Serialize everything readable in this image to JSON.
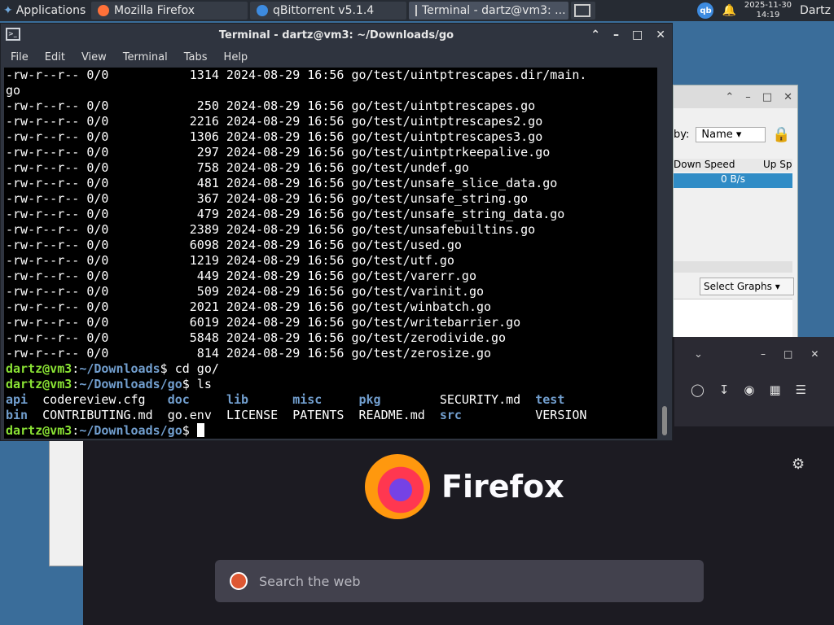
{
  "taskbar": {
    "apps_label": "Applications",
    "windows": [
      {
        "title": "Mozilla Firefox",
        "icon": "firefox-icon"
      },
      {
        "title": "qBittorrent v5.1.4",
        "icon": "qbittorrent-icon"
      },
      {
        "title": "Terminal - dartz@vm3: ...",
        "icon": "terminal-icon"
      }
    ],
    "qb_tray": "qb",
    "date": "2025-11-30",
    "time": "14:19",
    "user": "Dartz"
  },
  "qbittorrent": {
    "sort_label": "by:",
    "sort_value": "Name",
    "col_down": "Down Speed",
    "col_up": "Up Sp",
    "down_speed": "0 B/s",
    "graphs_select": "Select Graphs"
  },
  "firefox": {
    "brand": "Firefox",
    "search_placeholder": "Search the web"
  },
  "terminal": {
    "title": "Terminal - dartz@vm3: ~/Downloads/go",
    "menu": [
      "File",
      "Edit",
      "View",
      "Terminal",
      "Tabs",
      "Help"
    ],
    "listing": [
      "-rw-r--r-- 0/0           1314 2024-08-29 16:56 go/test/uintptrescapes.dir/main.",
      "go",
      "-rw-r--r-- 0/0            250 2024-08-29 16:56 go/test/uintptrescapes.go",
      "-rw-r--r-- 0/0           2216 2024-08-29 16:56 go/test/uintptrescapes2.go",
      "-rw-r--r-- 0/0           1306 2024-08-29 16:56 go/test/uintptrescapes3.go",
      "-rw-r--r-- 0/0            297 2024-08-29 16:56 go/test/uintptrkeepalive.go",
      "-rw-r--r-- 0/0            758 2024-08-29 16:56 go/test/undef.go",
      "-rw-r--r-- 0/0            481 2024-08-29 16:56 go/test/unsafe_slice_data.go",
      "-rw-r--r-- 0/0            367 2024-08-29 16:56 go/test/unsafe_string.go",
      "-rw-r--r-- 0/0            479 2024-08-29 16:56 go/test/unsafe_string_data.go",
      "-rw-r--r-- 0/0           2389 2024-08-29 16:56 go/test/unsafebuiltins.go",
      "-rw-r--r-- 0/0           6098 2024-08-29 16:56 go/test/used.go",
      "-rw-r--r-- 0/0           1219 2024-08-29 16:56 go/test/utf.go",
      "-rw-r--r-- 0/0            449 2024-08-29 16:56 go/test/varerr.go",
      "-rw-r--r-- 0/0            509 2024-08-29 16:56 go/test/varinit.go",
      "-rw-r--r-- 0/0           2021 2024-08-29 16:56 go/test/winbatch.go",
      "-rw-r--r-- 0/0           6019 2024-08-29 16:56 go/test/writebarrier.go",
      "-rw-r--r-- 0/0           5848 2024-08-29 16:56 go/test/zerodivide.go",
      "-rw-r--r-- 0/0            814 2024-08-29 16:56 go/test/zerosize.go"
    ],
    "prompt_user": "dartz@vm3",
    "prompt_path1": "~/Downloads",
    "cmd1": " cd go/",
    "prompt_path2": "~/Downloads/go",
    "cmd2": " ls",
    "ls_row1": [
      {
        "t": "api",
        "dir": true
      },
      {
        "t": "codereview.cfg",
        "dir": false
      },
      {
        "t": "doc",
        "dir": true
      },
      {
        "t": "lib",
        "dir": true
      },
      {
        "t": "misc",
        "dir": true
      },
      {
        "t": "pkg",
        "dir": true
      },
      {
        "t": "SECURITY.md",
        "dir": false
      },
      {
        "t": "test",
        "dir": true
      }
    ],
    "ls_row2": [
      {
        "t": "bin",
        "dir": true
      },
      {
        "t": "CONTRIBUTING.md",
        "dir": false
      },
      {
        "t": "go.env",
        "dir": false
      },
      {
        "t": "LICENSE",
        "dir": false
      },
      {
        "t": "PATENTS",
        "dir": false
      },
      {
        "t": "README.md",
        "dir": false
      },
      {
        "t": "src",
        "dir": true
      },
      {
        "t": "VERSION",
        "dir": false
      }
    ],
    "prompt_path3": "~/Downloads/go"
  }
}
